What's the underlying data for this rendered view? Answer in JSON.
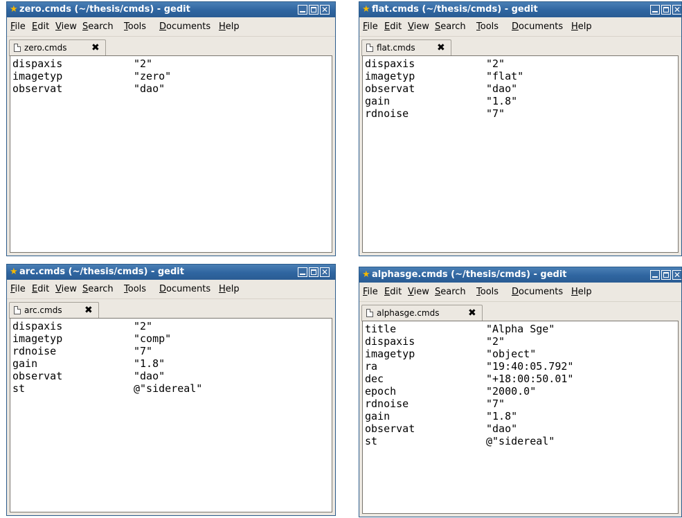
{
  "windows": [
    {
      "title": "zero.cmds (~/thesis/cmds) - gedit",
      "tab": "zero.cmds",
      "lines": [
        {
          "key": "dispaxis",
          "value": "\"2\""
        },
        {
          "key": "imagetyp",
          "value": "\"zero\""
        },
        {
          "key": "observat",
          "value": "\"dao\""
        }
      ]
    },
    {
      "title": "flat.cmds (~/thesis/cmds) - gedit",
      "tab": "flat.cmds",
      "lines": [
        {
          "key": "dispaxis",
          "value": "\"2\""
        },
        {
          "key": "imagetyp",
          "value": "\"flat\""
        },
        {
          "key": "observat",
          "value": "\"dao\""
        },
        {
          "key": "gain",
          "value": "\"1.8\""
        },
        {
          "key": "rdnoise",
          "value": "\"7\""
        }
      ]
    },
    {
      "title": "arc.cmds (~/thesis/cmds) - gedit",
      "tab": "arc.cmds",
      "lines": [
        {
          "key": "dispaxis",
          "value": "\"2\""
        },
        {
          "key": "imagetyp",
          "value": "\"comp\""
        },
        {
          "key": "rdnoise",
          "value": "\"7\""
        },
        {
          "key": "gain",
          "value": "\"1.8\""
        },
        {
          "key": "observat",
          "value": "\"dao\""
        },
        {
          "key": "st",
          "value": "@\"sidereal\""
        }
      ]
    },
    {
      "title": "alphasge.cmds (~/thesis/cmds) - gedit",
      "tab": "alphasge.cmds",
      "lines": [
        {
          "key": "title",
          "value": "\"Alpha Sge\""
        },
        {
          "key": "dispaxis",
          "value": "\"2\""
        },
        {
          "key": "imagetyp",
          "value": "\"object\""
        },
        {
          "key": "ra",
          "value": "\"19:40:05.792\""
        },
        {
          "key": "dec",
          "value": "\"+18:00:50.01\""
        },
        {
          "key": "epoch",
          "value": "\"2000.0\""
        },
        {
          "key": "rdnoise",
          "value": "\"7\""
        },
        {
          "key": "gain",
          "value": "\"1.8\""
        },
        {
          "key": "observat",
          "value": "\"dao\""
        },
        {
          "key": "st",
          "value": "@\"sidereal\""
        }
      ]
    }
  ],
  "menu": [
    {
      "key": "E",
      "rest": "ile"
    },
    {
      "key": "E",
      "rest": "dit"
    },
    {
      "key": "V",
      "rest": "iew"
    },
    {
      "key": "S",
      "rest": "earch"
    },
    {
      "key": "T",
      "rest": "ools"
    },
    {
      "key": "D",
      "rest": "ocuments"
    },
    {
      "key": "H",
      "rest": "elp"
    }
  ],
  "menu_first": {
    "key": "F",
    "rest": "ile"
  },
  "icons": {
    "app": "star-icon",
    "doc": "document-icon",
    "close": "close-icon"
  },
  "colors": {
    "titlebar": "#2f65a0",
    "window_bg": "#ece8e1",
    "editor_bg": "#ffffff"
  }
}
